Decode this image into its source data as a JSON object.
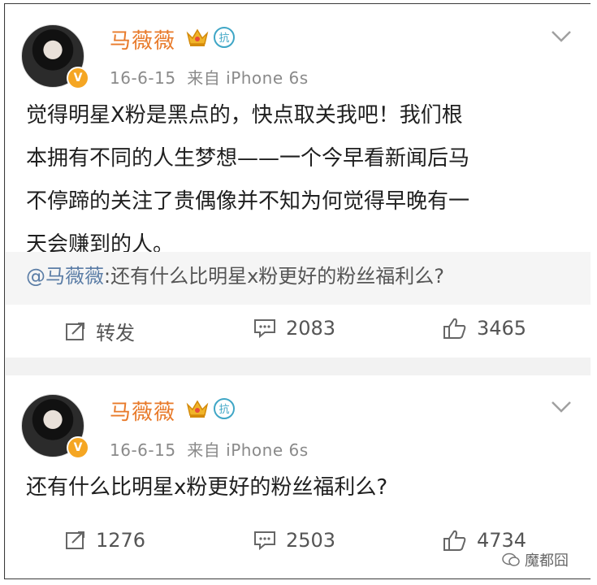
{
  "posts": [
    {
      "author": "马薇薇",
      "date": "16-6-15",
      "source": "来自 iPhone 6s",
      "content": [
        "觉得明星X粉是黑点的，快点取关我吧！我们根",
        "本拥有不同的人生梦想——一个今早看新闻后马",
        "不停蹄的关注了贵偶像并不知为何觉得早晚有一",
        "天会赚到的人。"
      ],
      "repost_at": "@马薇薇",
      "repost_text": ":还有什么比明星x粉更好的粉丝福利么?",
      "repost_label": "转发",
      "comments": "2083",
      "likes": "3465"
    },
    {
      "author": "马薇薇",
      "date": "16-6-15",
      "source": "来自 iPhone 6s",
      "content": [
        "还有什么比明星x粉更好的粉丝福利么?"
      ],
      "reposts": "1276",
      "comments": "2503",
      "likes": "4734"
    }
  ],
  "badges": {
    "vip": "V",
    "shield": "抗"
  },
  "watermark": "魔都囧",
  "colors": {
    "name": "#e87a2a",
    "at": "#5b7da6",
    "meta": "#8a8a8a",
    "badge": "#f5a623",
    "shield": "#3fa6c6"
  }
}
